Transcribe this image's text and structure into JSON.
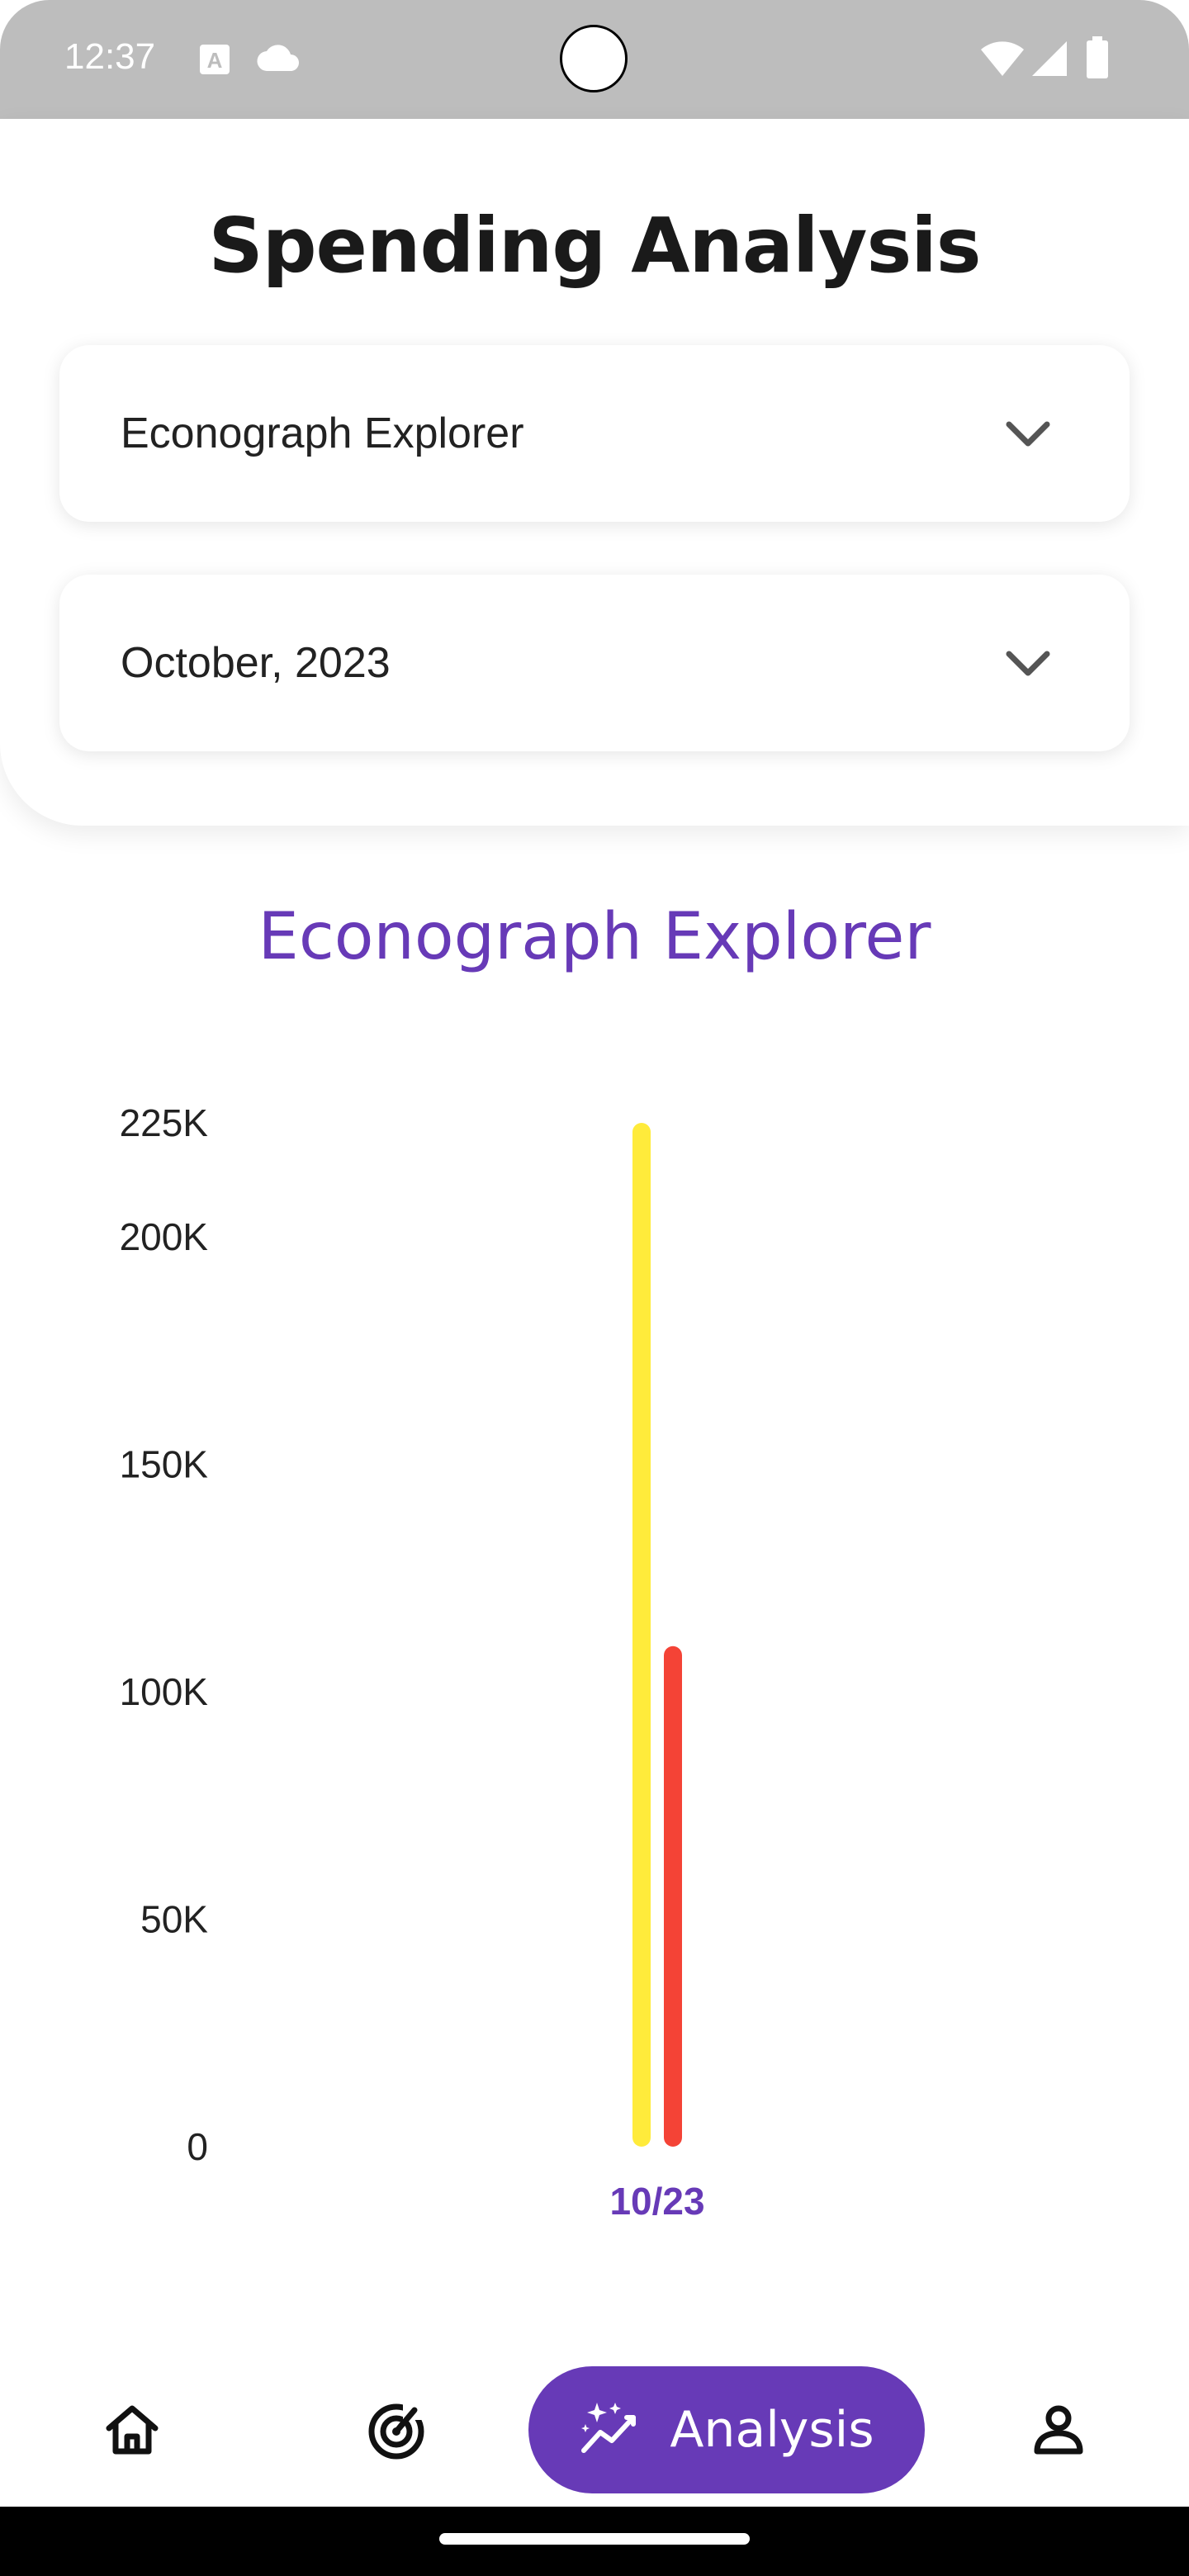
{
  "status_bar": {
    "time": "12:37",
    "icons": [
      "a-notification-icon",
      "cloud-icon",
      "wifi-icon",
      "cellular-signal-icon",
      "battery-icon"
    ]
  },
  "header": {
    "title": "Spending Analysis",
    "account_dropdown": {
      "value": "Econograph Explorer",
      "icon": "chevron-down-icon"
    },
    "month_dropdown": {
      "value": "October, 2023",
      "icon": "chevron-down-icon"
    }
  },
  "chart_title": "Econograph Explorer",
  "chart_data": {
    "type": "bar",
    "categories": [
      "10/23"
    ],
    "series": [
      {
        "color": "#ffeb3b",
        "values": [
          225000
        ]
      },
      {
        "color": "#f44336",
        "values": [
          110000
        ]
      }
    ],
    "y_ticks": [
      {
        "value": 0,
        "label": "0"
      },
      {
        "value": 50000,
        "label": "50K"
      },
      {
        "value": 100000,
        "label": "100K"
      },
      {
        "value": 150000,
        "label": "150K"
      },
      {
        "value": 200000,
        "label": "200K"
      },
      {
        "value": 225000,
        "label": "225K"
      }
    ],
    "ylim": [
      0,
      225000
    ],
    "grid": false,
    "legend": "none"
  },
  "bottom_nav": {
    "items": [
      {
        "icon": "home-icon",
        "active": false
      },
      {
        "icon": "radar-icon",
        "active": false
      },
      {
        "icon": "sparkle-chart-icon",
        "label": "Analysis",
        "active": true
      },
      {
        "icon": "person-icon",
        "active": false
      }
    ]
  },
  "colors": {
    "accent": "#673ab7",
    "status_bar": "#bdbdbd",
    "income_bar": "#ffeb3b",
    "expense_bar": "#f44336"
  }
}
